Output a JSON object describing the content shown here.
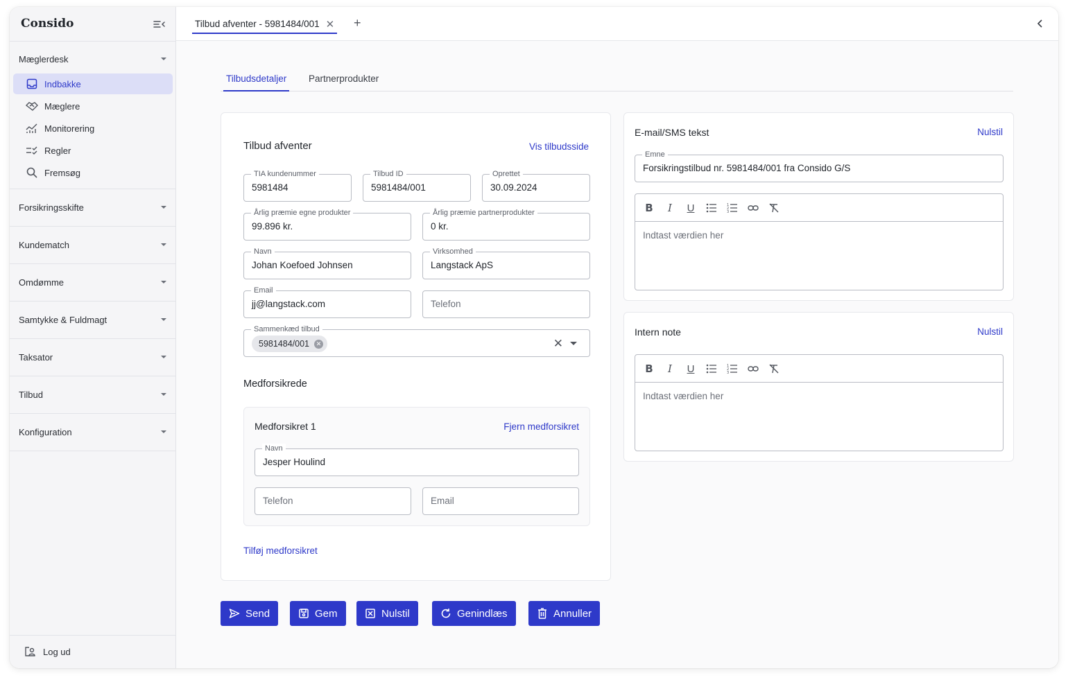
{
  "app": {
    "name": "Consido"
  },
  "sidebar": {
    "groups": [
      {
        "label": "Mæglerdesk"
      },
      {
        "label": "Forsikringsskifte"
      },
      {
        "label": "Kundematch"
      },
      {
        "label": "Omdømme"
      },
      {
        "label": "Samtykke & Fuldmagt"
      },
      {
        "label": "Taksator"
      },
      {
        "label": "Tilbud"
      },
      {
        "label": "Konfiguration"
      }
    ],
    "items": [
      {
        "label": "Indbakke",
        "icon": "inbox-icon",
        "active": true
      },
      {
        "label": "Mæglere",
        "icon": "handshake-icon"
      },
      {
        "label": "Monitorering",
        "icon": "chart-icon"
      },
      {
        "label": "Regler",
        "icon": "rules-icon"
      },
      {
        "label": "Fremsøg",
        "icon": "search-icon"
      }
    ],
    "logout_label": "Log ud"
  },
  "topbar": {
    "tab_label": "Tilbud afventer - 5981484/001"
  },
  "tabs": [
    {
      "label": "Tilbudsdetaljer",
      "active": true
    },
    {
      "label": "Partnerprodukter"
    }
  ],
  "offer": {
    "title": "Tilbud afventer",
    "view_link": "Vis tilbudsside",
    "fields": {
      "tia": {
        "label": "TIA kundenummer",
        "value": "5981484"
      },
      "offer_id": {
        "label": "Tilbud ID",
        "value": "5981484/001"
      },
      "created": {
        "label": "Oprettet",
        "value": "30.09.2024"
      },
      "premium_own": {
        "label": "Årlig præmie egne produkter",
        "value": "99.896 kr."
      },
      "premium_partner": {
        "label": "Årlig præmie partnerprodukter",
        "value": "0 kr."
      },
      "name": {
        "label": "Navn",
        "value": "Johan Koefoed Johnsen"
      },
      "company": {
        "label": "Virksomhed",
        "value": "Langstack ApS"
      },
      "email": {
        "label": "Email",
        "value": "jj@langstack.com"
      },
      "phone": {
        "placeholder": "Telefon"
      },
      "linked": {
        "label": "Sammenkæd tilbud",
        "chip": "5981484/001"
      }
    },
    "coinsured_title": "Medforsikrede",
    "coinsured": {
      "title": "Medforsikret 1",
      "remove_link": "Fjern medforsikret",
      "name_label": "Navn",
      "name_value": "Jesper Houlind",
      "phone_placeholder": "Telefon",
      "email_placeholder": "Email"
    },
    "add_coinsured": "Tilføj medforsikret"
  },
  "email_card": {
    "title": "E-mail/SMS tekst",
    "reset": "Nulstil",
    "subject_label": "Emne",
    "subject_value": "Forsikringstilbud nr. 5981484/001 fra Consido G/S",
    "placeholder": "Indtast værdien her"
  },
  "note_card": {
    "title": "Intern note",
    "reset": "Nulstil",
    "placeholder": "Indtast værdien her"
  },
  "actions": {
    "send": "Send",
    "save": "Gem",
    "reset": "Nulstil",
    "reload": "Genindlæs",
    "cancel": "Annuller"
  },
  "colors": {
    "accent": "#2e39c9",
    "active_bg": "#dcdef7"
  }
}
